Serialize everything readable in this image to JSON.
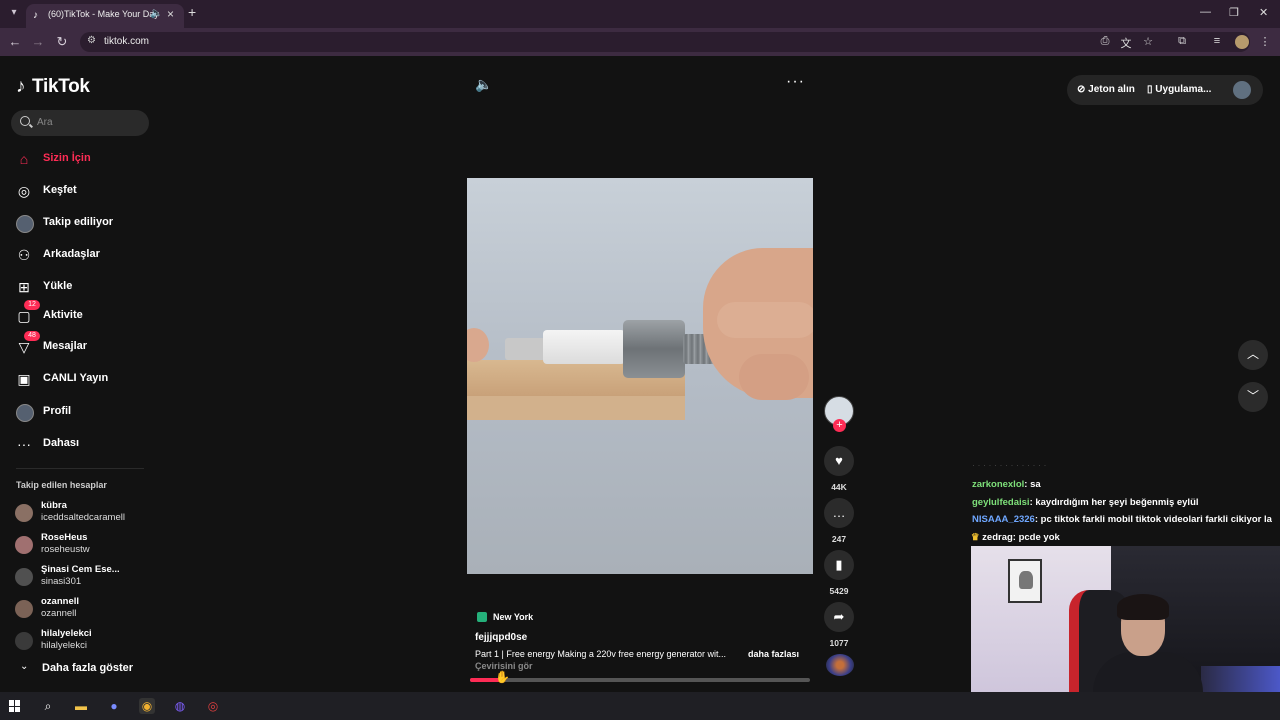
{
  "browser": {
    "tab_title": "(60)TikTok - Make Your Day",
    "url": "tiktok.com"
  },
  "sidebar": {
    "logo": "TikTok",
    "search_placeholder": "Ara",
    "nav": [
      {
        "label": "Sizin İçin",
        "active": true
      },
      {
        "label": "Keşfet"
      },
      {
        "label": "Takip ediliyor"
      },
      {
        "label": "Arkadaşlar"
      },
      {
        "label": "Yükle"
      },
      {
        "label": "Aktivite",
        "badge": "12"
      },
      {
        "label": "Mesajlar",
        "badge": "48"
      },
      {
        "label": "CANLI Yayın"
      },
      {
        "label": "Profil"
      },
      {
        "label": "Dahası"
      }
    ],
    "following_title": "Takip edilen hesaplar",
    "accounts": [
      {
        "name": "kübra",
        "user": "iceddsaltedcaramell"
      },
      {
        "name": "RoseHeus",
        "user": "roseheustw"
      },
      {
        "name": "Şinasi Cem Ese...",
        "user": "sinasi301"
      },
      {
        "name": "ozannell",
        "user": "ozannell"
      },
      {
        "name": "hilalyelekci",
        "user": "hilalyelekci"
      }
    ],
    "show_more": "Daha fazla göster"
  },
  "header": {
    "coins": "Jeton alın",
    "app": "Uygulama..."
  },
  "video": {
    "location": "New York",
    "author": "fejjjqpd0se",
    "description": "Part 1 | Free energy Making a 220v free energy generator wit...",
    "more": "daha fazlası",
    "translate": "Çevirisini gör",
    "progress": 0.09,
    "likes": "44K",
    "comments": "247",
    "saves": "5429",
    "shares": "1077"
  },
  "chat": [
    {
      "name": "zarkonexlol",
      "msg": ": sa",
      "color": "#7ee07a"
    },
    {
      "name": "geylulfedaisi",
      "msg": ": kaydırdığım her şeyi beğenmiş eylül",
      "color": "#7ee07a"
    },
    {
      "name": "NISAAA_2326",
      "msg": ": pc tiktok farkli mobil tiktok videolari farkli cikiyor la",
      "color": "#6fa7ff"
    },
    {
      "name": "zedrag",
      "msg": ": pcde yok",
      "color": "#ffffff"
    }
  ]
}
